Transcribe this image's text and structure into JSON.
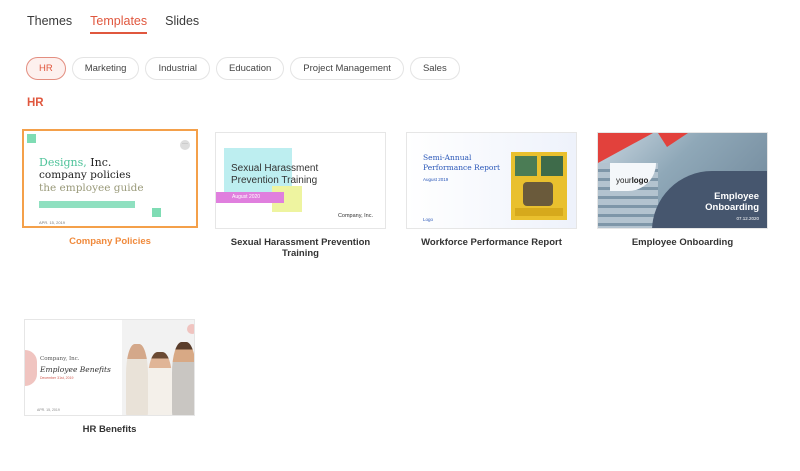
{
  "tabs": [
    {
      "label": "Themes"
    },
    {
      "label": "Templates"
    },
    {
      "label": "Slides"
    }
  ],
  "active_tab": "Templates",
  "chips": [
    {
      "label": "HR"
    },
    {
      "label": "Marketing"
    },
    {
      "label": "Industrial"
    },
    {
      "label": "Education"
    },
    {
      "label": "Project Management"
    },
    {
      "label": "Sales"
    }
  ],
  "active_chip": "HR",
  "section_title": "HR",
  "cards": [
    {
      "caption": "Company Policies",
      "selected": true,
      "thumb": {
        "line1_a": "Designs,",
        "line1_b": " Inc.",
        "line2": "company policies",
        "line3": "the employee guide",
        "footer": "APR. 15, 2019",
        "menu": "···"
      }
    },
    {
      "caption": "Sexual Harassment Prevention Training",
      "thumb": {
        "title_1": "Sexual Harassment",
        "title_2": "Prevention Training",
        "date": "August 2020",
        "company": "Company, Inc."
      }
    },
    {
      "caption": "Workforce Performance Report",
      "thumb": {
        "title_1": "Semi-Annual",
        "title_2": "Performance Report",
        "date": "August 2019",
        "logo": "Logo"
      }
    },
    {
      "caption": "Employee Onboarding",
      "thumb": {
        "logo_a": "your",
        "logo_b": "logo",
        "title_1": "Employee",
        "title_2": "Onboarding",
        "date": "07.12.2020"
      }
    },
    {
      "caption": "HR Benefits",
      "thumb": {
        "company": "Company, Inc.",
        "title": "Employee Benefits",
        "subtitle": "December 31st, 2019",
        "footer": "APR. 15, 2019"
      }
    }
  ],
  "colors": {
    "accent": "#e0573e",
    "selected_border": "#f4a04a",
    "selected_caption": "#f08a3c"
  }
}
